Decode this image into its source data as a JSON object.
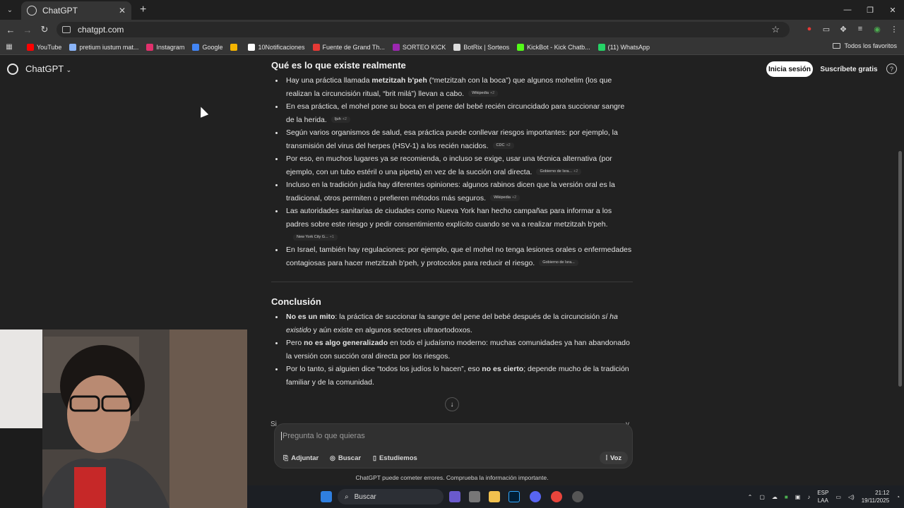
{
  "browser": {
    "tab_title": "ChatGPT",
    "url": "chatgpt.com",
    "bookmarks": [
      {
        "label": "YouTube",
        "color": "#ff0000"
      },
      {
        "label": "pretium iustum mat...",
        "color": "#8ab4f8"
      },
      {
        "label": "Instagram",
        "color": "#e1306c"
      },
      {
        "label": "Google",
        "color": "#4285f4"
      },
      {
        "label": "",
        "color": "#f4b400"
      },
      {
        "label": "10Notificaciones",
        "color": "#ffffff"
      },
      {
        "label": "Fuente de Grand Th...",
        "color": "#e53935"
      },
      {
        "label": "SORTEO KICK",
        "color": "#9c27b0"
      },
      {
        "label": "BotRix | Sorteos",
        "color": "#dddddd"
      },
      {
        "label": "KickBot - Kick Chatb...",
        "color": "#53fc18"
      },
      {
        "label": "(11) WhatsApp",
        "color": "#25d366"
      }
    ],
    "all_bookmarks": "Todos los favoritos"
  },
  "app": {
    "brand": "ChatGPT",
    "login": "Inicia sesión",
    "signup": "Suscríbete gratis",
    "help": "?"
  },
  "article": {
    "section1_title": "Qué es lo que existe realmente",
    "section2_title": "Conclusión",
    "bullets1": [
      {
        "parts": [
          [
            "t",
            "Hay una práctica llamada "
          ],
          [
            "b",
            "metzitzah b'peh"
          ],
          [
            "t",
            " (“metzitzah con la boca”) que algunos mohelim (los que realizan la circuncisión ritual, “brit milá”) llevan a cabo."
          ]
        ],
        "cite": "Wikipedia",
        "more": "+2",
        "cite_newline": false
      },
      {
        "parts": [
          [
            "t",
            "En esa práctica, el mohel pone su boca en el pene del bebé recién circuncidado para succionar sangre de la herida."
          ]
        ],
        "cite": "Ijuh",
        "more": "+2",
        "cite_newline": false
      },
      {
        "parts": [
          [
            "t",
            "Según varios organismos de salud, esa práctica puede conllevar riesgos importantes: por ejemplo, la transmisión del virus del herpes (HSV-1) a los recién nacidos."
          ]
        ],
        "cite": "CDC",
        "more": "+2",
        "cite_newline": false
      },
      {
        "parts": [
          [
            "t",
            "Por eso, en muchos lugares ya se recomienda, o incluso se exige, usar una técnica alternativa (por ejemplo, con un tubo estéril o una pipeta) en vez de la succión oral directa."
          ]
        ],
        "cite": "Gobierno de Isra...",
        "more": "+2",
        "cite_newline": false
      },
      {
        "parts": [
          [
            "t",
            "Incluso en la tradición judía hay diferentes opiniones: algunos rabinos dicen que la versión oral es la tradicional, otros permiten o prefieren métodos más seguros."
          ]
        ],
        "cite": "Wikipedia",
        "more": "+2",
        "cite_newline": false
      },
      {
        "parts": [
          [
            "t",
            "Las autoridades sanitarias de ciudades como Nueva York han hecho campañas para informar a los padres sobre este riesgo y pedir consentimiento explícito cuando se va a realizar metzitzah b'peh."
          ]
        ],
        "cite": "New York City G...",
        "more": "+1",
        "cite_newline": true
      },
      {
        "parts": [
          [
            "t",
            "En Israel, también hay regulaciones: por ejemplo, que el mohel no tenga lesiones orales o enfermedades contagiosas para hacer metzitzah b'peh, y protocolos para reducir el riesgo."
          ]
        ],
        "cite": "Gobierno de Isra...",
        "more": "",
        "cite_newline": false
      }
    ],
    "bullets2": [
      {
        "parts": [
          [
            "b",
            "No es un mito"
          ],
          [
            "t",
            ": la práctica de succionar la sangre del pene del bebé después de la circuncisión "
          ],
          [
            "i",
            "sí ha existido"
          ],
          [
            "t",
            " y aún existe en algunos sectores ultraortodoxos."
          ]
        ]
      },
      {
        "parts": [
          [
            "t",
            "Pero "
          ],
          [
            "b",
            "no es algo generalizado"
          ],
          [
            "t",
            " en todo el judaísmo moderno: muchas comunidades ya han abandonado la versión con succión oral directa por los riesgos."
          ]
        ]
      },
      {
        "parts": [
          [
            "t",
            "Por lo tanto, si alguien dice “todos los judíos lo hacen”, eso "
          ],
          [
            "b",
            "no es cierto"
          ],
          [
            "t",
            "; depende mucho de la tradición familiar y de la comunidad."
          ]
        ]
      }
    ],
    "cut_left": "Si",
    "cut_right": "y"
  },
  "composer": {
    "placeholder": "Pregunta lo que quieras",
    "attach": "Adjuntar",
    "search": "Buscar",
    "study": "Estudiemos",
    "voice": "Voz"
  },
  "disclaimer": "ChatGPT puede cometer errores. Comprueba la información importante.",
  "taskbar": {
    "search": "Buscar",
    "lang": "ESP",
    "lang2": "LAA",
    "time": "21:12",
    "date": "19/11/2025"
  }
}
